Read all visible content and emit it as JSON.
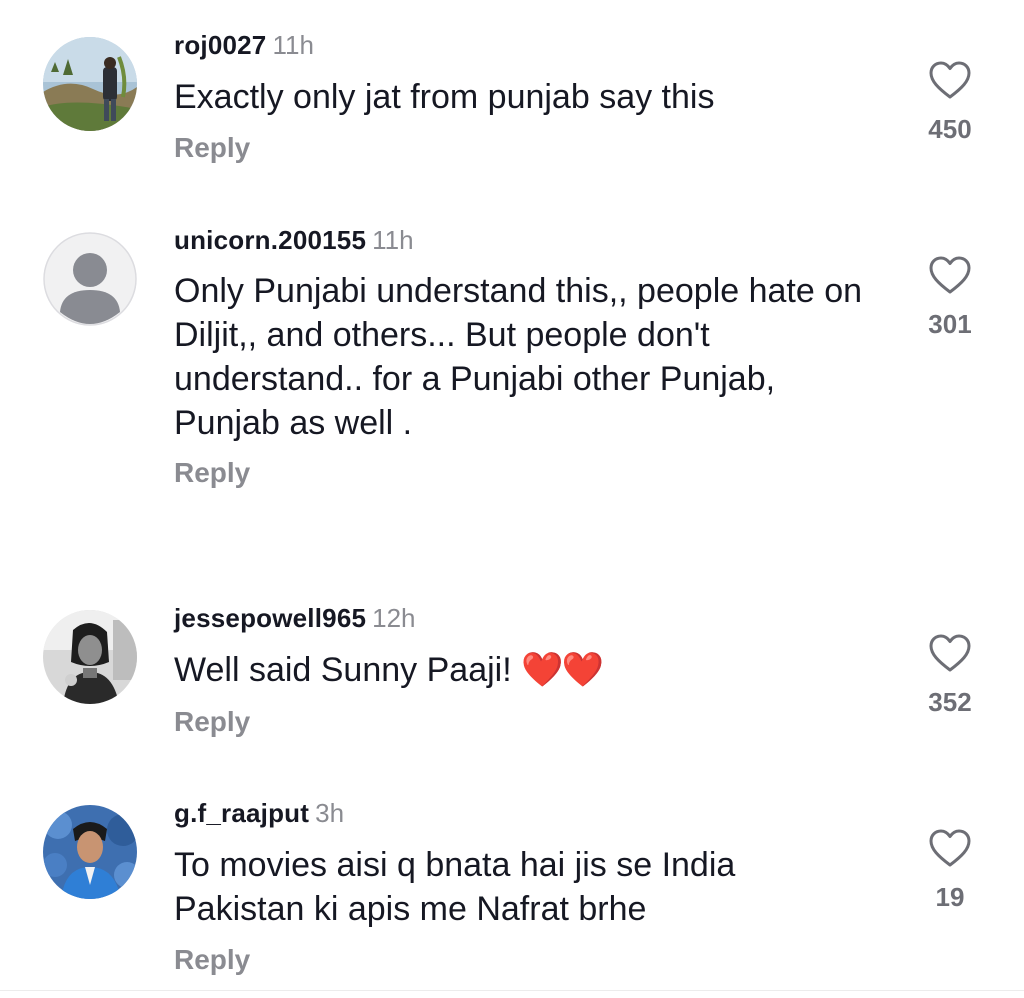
{
  "comments": [
    {
      "username": "roj0027",
      "time": "11h",
      "text": "Exactly only jat from punjab say this",
      "reply_label": "Reply",
      "likes": "450"
    },
    {
      "username": "unicorn.200155",
      "time": "11h",
      "text": "Only Punjabi understand this,, people hate on Diljit,, and others... But people don't understand.. for a Punjabi other Punjab, Punjab as well .",
      "reply_label": "Reply",
      "likes": "301"
    },
    {
      "username": "jessepowell965",
      "time": "12h",
      "text": "Well said Sunny Paaji! ",
      "emoji": "❤️❤️",
      "reply_label": "Reply",
      "likes": "352"
    },
    {
      "username": "g.f_raajput",
      "time": "3h",
      "text": "To movies aisi q bnata hai jis se India Pakistan ki apis me Nafrat brhe",
      "reply_label": "Reply",
      "likes": "19"
    }
  ],
  "icons": {
    "like": "heart-outline-icon",
    "default_avatar": "person-icon"
  },
  "colors": {
    "text_primary": "#161823",
    "text_secondary": "#8a8b91",
    "like_count": "#6d6e75",
    "emoji_heart": "#e3242b"
  }
}
